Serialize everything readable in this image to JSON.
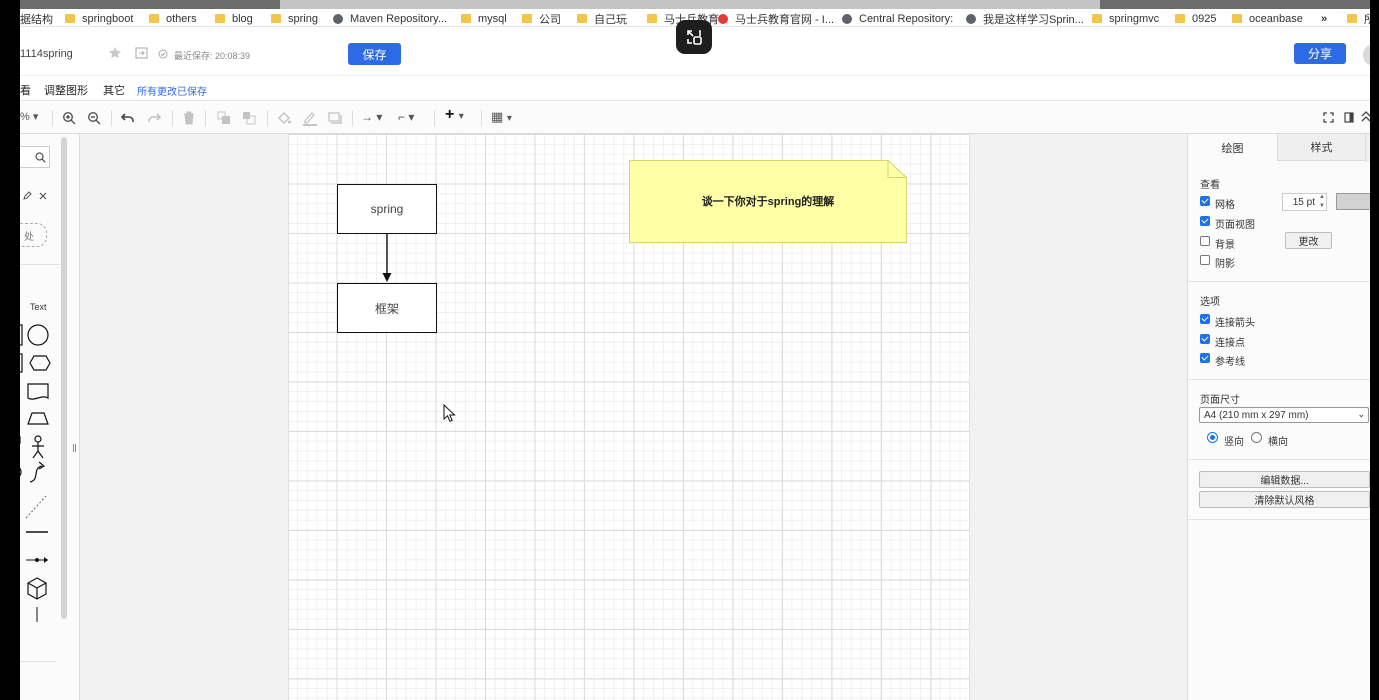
{
  "bookmarks": [
    {
      "label": "据结构",
      "icon": "folder-icon"
    },
    {
      "label": "springboot",
      "icon": "folder-icon"
    },
    {
      "label": "others",
      "icon": "folder-icon"
    },
    {
      "label": "blog",
      "icon": "folder-icon"
    },
    {
      "label": "spring",
      "icon": "folder-icon"
    },
    {
      "label": "Maven Repository...",
      "icon": "globe-icon"
    },
    {
      "label": "mysql",
      "icon": "folder-icon"
    },
    {
      "label": "公司",
      "icon": "folder-icon"
    },
    {
      "label": "自己玩",
      "icon": "folder-icon"
    },
    {
      "label": "马士兵教育",
      "icon": "folder-icon"
    },
    {
      "label": "马士兵教育官网 - I...",
      "icon": "red-logo-icon"
    },
    {
      "label": "Central Repository:",
      "icon": "globe-icon"
    },
    {
      "label": "我是这样学习Sprin...",
      "icon": "globe-icon"
    },
    {
      "label": "springmvc",
      "icon": "folder-icon"
    },
    {
      "label": "0925",
      "icon": "folder-icon"
    },
    {
      "label": "oceanbase",
      "icon": "folder-icon"
    }
  ],
  "bookmarks_more": "»",
  "bookmarks_last": "所",
  "header": {
    "doc_name": "1114spring",
    "last_saved": "最近保存: 20:08:39",
    "save_label": "保存",
    "share_label": "分享"
  },
  "menu": {
    "items": [
      "看",
      "调整图形",
      "其它"
    ],
    "status": "所有更改已保存"
  },
  "toolbar": {
    "zoom_fragment": "%"
  },
  "left_panel": {
    "search_icon": "search-icon",
    "placeholder_fragment": "处",
    "text_shape_label": "Text"
  },
  "diagram": {
    "node_spring": "spring",
    "node_framework": "框架",
    "note_text": "谈一下你对于spring的理解",
    "note_color": "#ffffa6"
  },
  "right_panel": {
    "tabs": [
      "绘图",
      "样式"
    ],
    "view_section": "查看",
    "grid_label": "网格",
    "grid_size": "15 pt",
    "page_view_label": "页面视图",
    "background_label": "背景",
    "change_label": "更改",
    "shadow_label": "阴影",
    "options_section": "选项",
    "connect_arrows_label": "连接箭头",
    "connect_points_label": "连接点",
    "guides_label": "参考线",
    "page_size_section": "页面尺寸",
    "page_size_value": "A4 (210 mm x 297 mm)",
    "portrait_label": "竖向",
    "landscape_label": "横向",
    "edit_data_label": "编辑数据...",
    "clear_style_label": "清除默认风格"
  },
  "accent_color": "#2d6be4"
}
